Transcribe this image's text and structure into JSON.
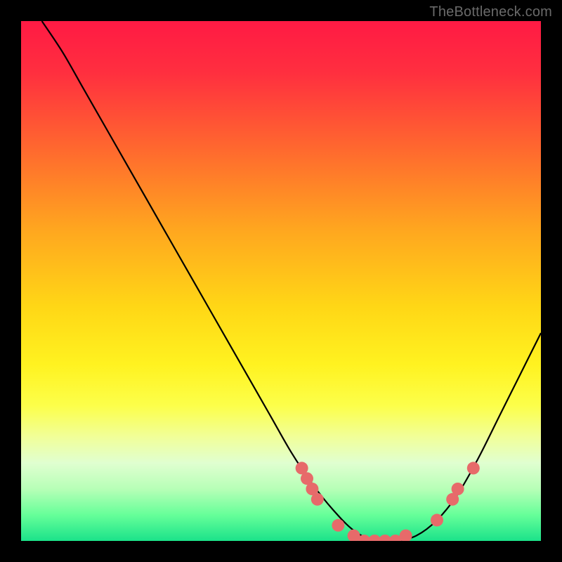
{
  "watermark": "TheBottleneck.com",
  "gradient": {
    "stops": [
      {
        "offset": 0.0,
        "color": "#ff1a44"
      },
      {
        "offset": 0.1,
        "color": "#ff2f3f"
      },
      {
        "offset": 0.25,
        "color": "#ff6a2e"
      },
      {
        "offset": 0.4,
        "color": "#ffa61f"
      },
      {
        "offset": 0.55,
        "color": "#ffd716"
      },
      {
        "offset": 0.66,
        "color": "#fff220"
      },
      {
        "offset": 0.74,
        "color": "#fcff4a"
      },
      {
        "offset": 0.8,
        "color": "#f1ff99"
      },
      {
        "offset": 0.85,
        "color": "#e0ffd0"
      },
      {
        "offset": 0.9,
        "color": "#b7ffb7"
      },
      {
        "offset": 0.95,
        "color": "#66ff99"
      },
      {
        "offset": 1.0,
        "color": "#1be28a"
      }
    ]
  },
  "chart_data": {
    "type": "line",
    "title": "",
    "xlabel": "",
    "ylabel": "",
    "xlim": [
      0,
      100
    ],
    "ylim": [
      0,
      100
    ],
    "series": [
      {
        "name": "bottleneck-curve",
        "x": [
          4,
          8,
          12,
          16,
          20,
          24,
          28,
          32,
          36,
          40,
          44,
          48,
          52,
          56,
          60,
          64,
          68,
          72,
          76,
          80,
          84,
          88,
          92,
          96,
          100
        ],
        "y": [
          100,
          94,
          87,
          80,
          73,
          66,
          59,
          52,
          45,
          38,
          31,
          24,
          17,
          11,
          6,
          2,
          0,
          0,
          1,
          4,
          9,
          16,
          24,
          32,
          40
        ]
      }
    ],
    "markers": {
      "name": "highlight-points",
      "color": "#e76a6a",
      "radius": 9,
      "points": [
        {
          "x": 54,
          "y": 14
        },
        {
          "x": 55,
          "y": 12
        },
        {
          "x": 56,
          "y": 10
        },
        {
          "x": 57,
          "y": 8
        },
        {
          "x": 61,
          "y": 3
        },
        {
          "x": 64,
          "y": 1
        },
        {
          "x": 66,
          "y": 0
        },
        {
          "x": 68,
          "y": 0
        },
        {
          "x": 70,
          "y": 0
        },
        {
          "x": 72,
          "y": 0
        },
        {
          "x": 74,
          "y": 1
        },
        {
          "x": 80,
          "y": 4
        },
        {
          "x": 83,
          "y": 8
        },
        {
          "x": 84,
          "y": 10
        },
        {
          "x": 87,
          "y": 14
        }
      ]
    }
  }
}
